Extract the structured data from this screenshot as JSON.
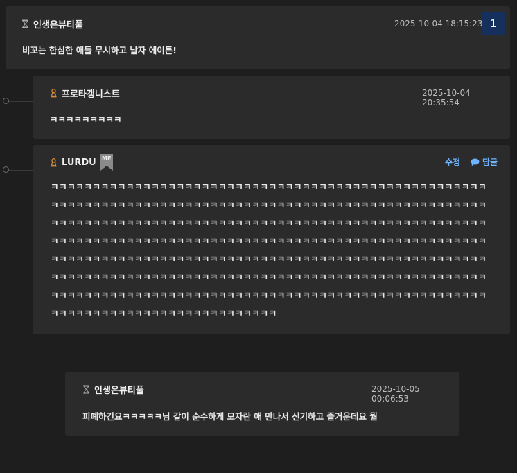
{
  "comments": [
    {
      "author": "인생은뷰티풀",
      "date": "2025-10-04 18:15:23",
      "text": "비꼬는 한심한 애들 무시하고 날자 에이튼!",
      "count": "1",
      "badge_icon": "hourglass-icon"
    },
    {
      "author": "프로타갱니스트",
      "date": "2025-10-04 20:35:54",
      "text": "ㅋㅋㅋㅋㅋㅋㅋㅋㅋ",
      "badge_icon": "pawn-icon"
    },
    {
      "author": "LURDU",
      "me_tag": "ME",
      "edit_label": "수정",
      "reply_label": "답글",
      "text": "ㅋㅋㅋㅋㅋㅋㅋㅋㅋㅋㅋㅋㅋㅋㅋㅋㅋㅋㅋㅋㅋㅋㅋㅋㅋㅋㅋㅋㅋㅋㅋㅋㅋㅋㅋㅋㅋㅋㅋㅋㅋㅋㅋㅋㅋㅋㅋㅋㅋㅋㅋㅋㅋㅋㅋㅋㅋㅋㅋㅋㅋㅋㅋㅋㅋㅋㅋㅋㅋㅋㅋㅋㅋㅋㅋㅋㅋㅋㅋㅋㅋㅋㅋㅋㅋㅋㅋㅋㅋㅋㅋㅋㅋㅋㅋㅋㅋㅋㅋㅋㅋㅋㅋㅋㅋㅋㅋㅋㅋㅋㅋㅋㅋㅋㅋㅋㅋㅋㅋㅋㅋㅋㅋㅋㅋㅋㅋㅋㅋㅋㅋㅋㅋㅋㅋㅋㅋㅋㅋㅋㅋㅋㅋㅋㅋㅋㅋㅋㅋㅋㅋㅋㅋㅋㅋㅋㅋㅋㅋㅋㅋㅋㅋㅋㅋㅋㅋㅋㅋㅋㅋㅋㅋㅋㅋㅋㅋㅋㅋㅋㅋㅋㅋㅋㅋㅋㅋㅋㅋㅋㅋㅋㅋㅋㅋㅋㅋㅋㅋㅋㅋㅋㅋㅋㅋㅋㅋㅋㅋㅋㅋㅋㅋㅋㅋㅋㅋㅋㅋㅋㅋㅋㅋㅋㅋㅋㅋㅋㅋㅋㅋㅋㅋㅋㅋㅋㅋㅋㅋㅋㅋㅋㅋㅋㅋㅋㅋㅋㅋㅋㅋㅋㅋㅋㅋㅋㅋㅋㅋㅋㅋㅋㅋㅋㅋㅋㅋㅋㅋㅋㅋㅋㅋㅋㅋㅋㅋㅋㅋㅋㅋㅋㅋㅋㅋㅋㅋㅋㅋㅋㅋㅋㅋㅋㅋㅋㅋㅋㅋㅋㅋㅋㅋㅋㅋㅋㅋㅋㅋㅋㅋㅋㅋㅋㅋㅋㅋㅋㅋㅋㅋㅋㅋㅋㅋㅋㅋㅋㅋㅋㅋㅋㅋㅋㅋㅋㅋㅋㅋㅋㅋㅋㅋㅋㅋㅋㅋㅋㅋㅋㅋㅋㅋㅋㅋㅋㅋㅋㅋㅋㅋㅋㅋㅋㅋㅋㅋㅋㅋㅋㅋㅋㅋㅋㅋㅋㅋㅋㅋㅋㅋㅋㅋㅋㅋㅋㅋㅋㅋㅋㅋ",
      "badge_icon": "pawn-icon"
    },
    {
      "author": "인생은뷰티풀",
      "date": "2025-10-05 00:06:53",
      "text": "피폐하긴요ㅋㅋㅋㅋㅋ님 같이 순수하게 모자란 애 만나서 신기하고 즐거운데요 뭘",
      "badge_icon": "hourglass-icon"
    }
  ],
  "colors": {
    "accent": "#6fb3ff",
    "count_bg": "#16305e",
    "card": "#2b2b2b",
    "bg": "#1e1e1e"
  }
}
